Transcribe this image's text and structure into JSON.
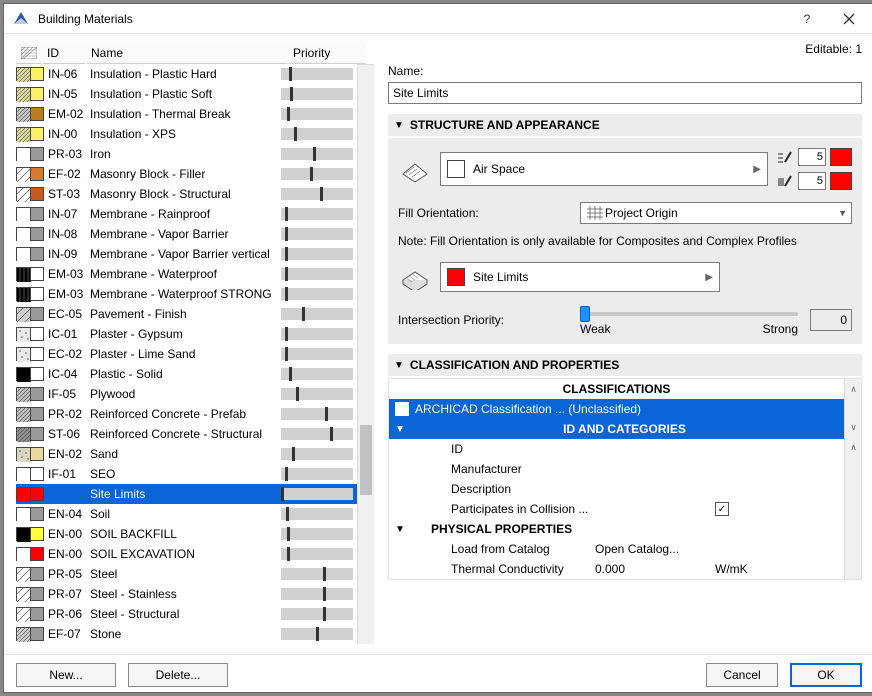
{
  "window": {
    "title": "Building Materials"
  },
  "editable_label": "Editable: 1",
  "columns": {
    "id": "ID",
    "name": "Name",
    "priority": "Priority"
  },
  "selected_index": 23,
  "materials": [
    {
      "id": "IN-06",
      "name": "Insulation - Plastic Hard",
      "p": 0.12,
      "c1": "#dcdca0",
      "c2": "#fff06a",
      "pat1": "hatch"
    },
    {
      "id": "IN-05",
      "name": "Insulation - Plastic Soft",
      "p": 0.13,
      "c1": "#dcdca0",
      "c2": "#fff06a",
      "pat1": "hatch"
    },
    {
      "id": "EM-02",
      "name": "Insulation - Thermal Break",
      "p": 0.08,
      "c1": "#c5c5c5",
      "c2": "#bb7e1d",
      "pat1": "hatch"
    },
    {
      "id": "IN-00",
      "name": "Insulation - XPS",
      "p": 0.18,
      "c1": "#dcdca0",
      "c2": "#fff06a",
      "pat1": "hatch"
    },
    {
      "id": "PR-03",
      "name": "Iron",
      "p": 0.46,
      "c1": "#ffffff",
      "c2": "#9a9a9a",
      "pat1": "none"
    },
    {
      "id": "EF-02",
      "name": "Masonry Block - Filler",
      "p": 0.42,
      "c1": "#ffffff",
      "c2": "#d87a2c",
      "pat1": "diag"
    },
    {
      "id": "ST-03",
      "name": "Masonry Block - Structural",
      "p": 0.55,
      "c1": "#ffffff",
      "c2": "#c85a1e",
      "pat1": "diag"
    },
    {
      "id": "IN-07",
      "name": "Membrane - Rainproof",
      "p": 0.05,
      "c1": "#ffffff",
      "c2": "#9a9a9a",
      "pat1": "none"
    },
    {
      "id": "IN-08",
      "name": "Membrane - Vapor Barrier",
      "p": 0.05,
      "c1": "#ffffff",
      "c2": "#9a9a9a",
      "pat1": "none"
    },
    {
      "id": "IN-09",
      "name": "Membrane - Vapor Barrier vertical",
      "p": 0.05,
      "c1": "#ffffff",
      "c2": "#9a9a9a",
      "pat1": "none"
    },
    {
      "id": "EM-03",
      "name": "Membrane - Waterproof",
      "p": 0.05,
      "c1": "#000000",
      "c2": "#ffffff",
      "pat1": "vert"
    },
    {
      "id": "EM-03",
      "name": "Membrane - Waterproof STRONG",
      "p": 0.06,
      "c1": "#000000",
      "c2": "#ffffff",
      "pat1": "vert"
    },
    {
      "id": "EC-05",
      "name": "Pavement - Finish",
      "p": 0.3,
      "c1": "#cfcfcf",
      "c2": "#9a9a9a",
      "pat1": "diag"
    },
    {
      "id": "IC-01",
      "name": "Plaster - Gypsum",
      "p": 0.06,
      "c1": "#e8e8e8",
      "c2": "#ffffff",
      "pat1": "dots"
    },
    {
      "id": "EC-02",
      "name": "Plaster - Lime Sand",
      "p": 0.06,
      "c1": "#e8e8e8",
      "c2": "#ffffff",
      "pat1": "dots"
    },
    {
      "id": "IC-04",
      "name": "Plastic - Solid",
      "p": 0.12,
      "c1": "#000000",
      "c2": "#ffffff",
      "pat1": "solid"
    },
    {
      "id": "IF-05",
      "name": "Plywood",
      "p": 0.22,
      "c1": "#bfbfbf",
      "c2": "#9a9a9a",
      "pat1": "hatch"
    },
    {
      "id": "PR-02",
      "name": "Reinforced Concrete - Prefab",
      "p": 0.63,
      "c1": "#bfbfbf",
      "c2": "#9a9a9a",
      "pat1": "hatch"
    },
    {
      "id": "ST-06",
      "name": "Reinforced Concrete - Structural",
      "p": 0.7,
      "c1": "#8e8e8e",
      "c2": "#9a9a9a",
      "pat1": "hatch"
    },
    {
      "id": "EN-02",
      "name": "Sand",
      "p": 0.15,
      "c1": "#d8d8c0",
      "c2": "#ebd7a0",
      "pat1": "dots"
    },
    {
      "id": "IF-01",
      "name": "SEO",
      "p": 0.06,
      "c1": "#ffffff",
      "c2": "#ffffff",
      "pat1": "none"
    },
    {
      "id": "",
      "name": "Site Limits",
      "p": 0.0,
      "c1": "#ff0000",
      "c2": "#ff0000",
      "pat1": "solid"
    },
    {
      "id": "EN-04",
      "name": "Soil",
      "p": 0.07,
      "c1": "#ffffff",
      "c2": "#9a9a9a",
      "pat1": "none"
    },
    {
      "id": "EN-00",
      "name": "SOIL BACKFILL",
      "p": 0.08,
      "c1": "#000000",
      "c2": "#ffff3a",
      "pat1": "solid"
    },
    {
      "id": "EN-00",
      "name": "SOIL EXCAVATION",
      "p": 0.08,
      "c1": "#ffffff",
      "c2": "#ff0000",
      "pat1": "none"
    },
    {
      "id": "PR-05",
      "name": "Steel",
      "p": 0.6,
      "c1": "#ffffff",
      "c2": "#9a9a9a",
      "pat1": "diag"
    },
    {
      "id": "PR-07",
      "name": "Steel - Stainless",
      "p": 0.6,
      "c1": "#ffffff",
      "c2": "#9a9a9a",
      "pat1": "diag"
    },
    {
      "id": "PR-06",
      "name": "Steel - Structural",
      "p": 0.6,
      "c1": "#ffffff",
      "c2": "#9a9a9a",
      "pat1": "diag"
    },
    {
      "id": "EF-07",
      "name": "Stone",
      "p": 0.5,
      "c1": "#cfcfcf",
      "c2": "#9a9a9a",
      "pat1": "hatch"
    }
  ],
  "right": {
    "name_label": "Name:",
    "name_value": "Site Limits",
    "section_struct": "STRUCTURE AND APPEARANCE",
    "fill_picker": "Air Space",
    "pen1": "5",
    "pen2": "5",
    "fo_label": "Fill Orientation:",
    "fo_value": "Project Origin",
    "fo_note": "Note: Fill Orientation is only available for Composites and Complex Profiles",
    "surface_value": "Site Limits",
    "ip_label": "Intersection Priority:",
    "ip_weak": "Weak",
    "ip_strong": "Strong",
    "ip_value": "0",
    "section_class": "CLASSIFICATION AND PROPERTIES",
    "classifications_hd": "CLASSIFICATIONS",
    "class_item": "ARCHICAD Classification ... (Unclassified)",
    "idcat_hd": "ID AND CATEGORIES",
    "props_id": "ID",
    "props_manu": "Manufacturer",
    "props_desc": "Description",
    "props_coll": "Participates in Collision ...",
    "phys_hd": "PHYSICAL PROPERTIES",
    "load_cat": "Load from Catalog",
    "open_cat": "Open Catalog...",
    "tc_label": "Thermal Conductivity",
    "tc_val": "0.000",
    "tc_unit": "W/mK"
  },
  "footer": {
    "new": "New...",
    "delete": "Delete...",
    "cancel": "Cancel",
    "ok": "OK"
  }
}
